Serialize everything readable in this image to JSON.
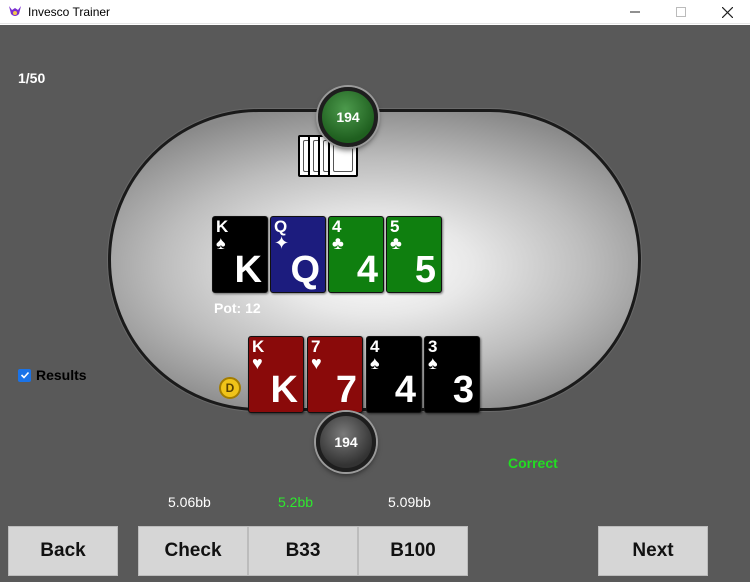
{
  "window": {
    "title": "Invesco Trainer"
  },
  "hand_counter": "1/50",
  "villain": {
    "stack": "194"
  },
  "hero": {
    "stack": "194"
  },
  "board": [
    {
      "rank": "K",
      "suit": "♠",
      "color": "#000000"
    },
    {
      "rank": "Q",
      "suit": "✦",
      "color": "#1c1c7e"
    },
    {
      "rank": "4",
      "suit": "♣",
      "color": "#0f7f0f"
    },
    {
      "rank": "5",
      "suit": "♣",
      "color": "#0f7f0f"
    }
  ],
  "pot_label": "Pot: 12",
  "hero_cards": [
    {
      "rank": "K",
      "suit": "♥",
      "color": "#8a0a0a"
    },
    {
      "rank": "7",
      "suit": "♥",
      "color": "#8a0a0a"
    },
    {
      "rank": "4",
      "suit": "♠",
      "color": "#000000"
    },
    {
      "rank": "3",
      "suit": "♠",
      "color": "#000000"
    }
  ],
  "dealer_button": "D",
  "results": {
    "label": "Results",
    "checked": true
  },
  "feedback": "Correct",
  "evs": [
    "5.06bb",
    "5.2bb",
    "5.09bb"
  ],
  "buttons": {
    "back": "Back",
    "check": "Check",
    "b33": "B33",
    "b100": "B100",
    "next": "Next"
  },
  "colors": {
    "accent_correct": "#22dd22",
    "table_bg": "#595959"
  }
}
